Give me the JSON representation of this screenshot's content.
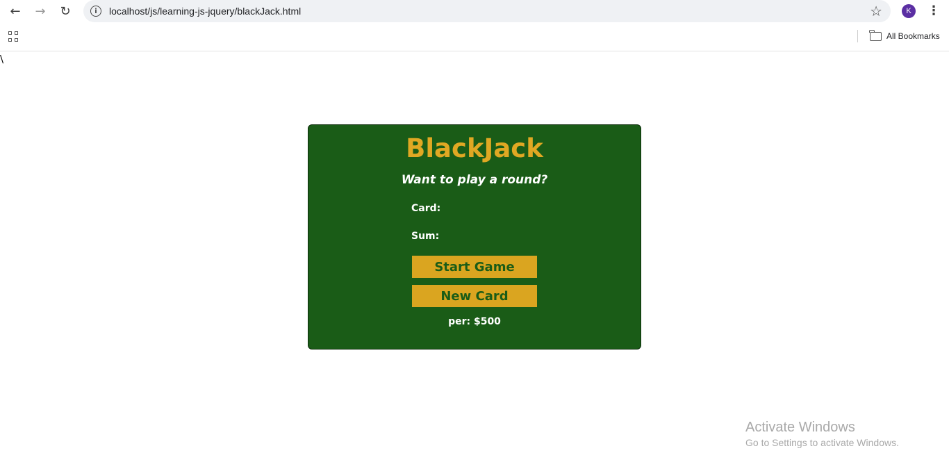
{
  "browser": {
    "url": "localhost/js/learning-js-jquery/blackJack.html",
    "avatar_initial": "K",
    "bookmarks_label": "All Bookmarks",
    "avatar_color": "#5b2fa3"
  },
  "page": {
    "stray_text": "\\",
    "title": "BlackJack",
    "message": "Want to play a round?",
    "cards_label": "Card:",
    "sum_label": "Sum:",
    "start_button": "Start Game",
    "new_card_button": "New Card",
    "player_info": "per: $500",
    "colors": {
      "card_background": "#1a5c17",
      "accent_gold": "#daa520",
      "title_gold": "#e0a823"
    }
  },
  "watermark": {
    "title": "Activate Windows",
    "subtitle": "Go to Settings to activate Windows."
  }
}
